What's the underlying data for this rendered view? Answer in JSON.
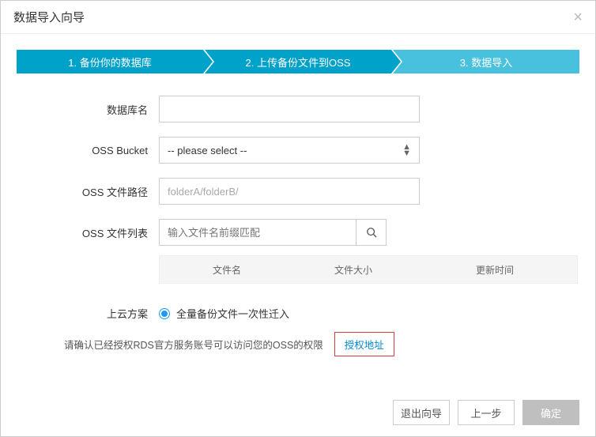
{
  "modal": {
    "title": "数据导入向导"
  },
  "steps": {
    "s1": "1. 备份你的数据库",
    "s2": "2. 上传备份文件到OSS",
    "s3": "3. 数据导入"
  },
  "form": {
    "dbname_label": "数据库名",
    "dbname_value": "",
    "bucket_label": "OSS Bucket",
    "bucket_selected": "-- please select --",
    "path_label": "OSS 文件路径",
    "path_value": "folderA/folderB/",
    "filelist_label": "OSS 文件列表",
    "filelist_search_placeholder": "输入文件名前缀匹配",
    "migration_label": "上云方案",
    "migration_option": "全量备份文件一次性迁入"
  },
  "table": {
    "col_name": "文件名",
    "col_size": "文件大小",
    "col_time": "更新时间"
  },
  "auth": {
    "note": "请确认已经授权RDS官方服务账号可以访问您的OSS的权限",
    "link": "授权地址"
  },
  "footer": {
    "exit": "退出向导",
    "prev": "上一步",
    "ok": "确定"
  }
}
